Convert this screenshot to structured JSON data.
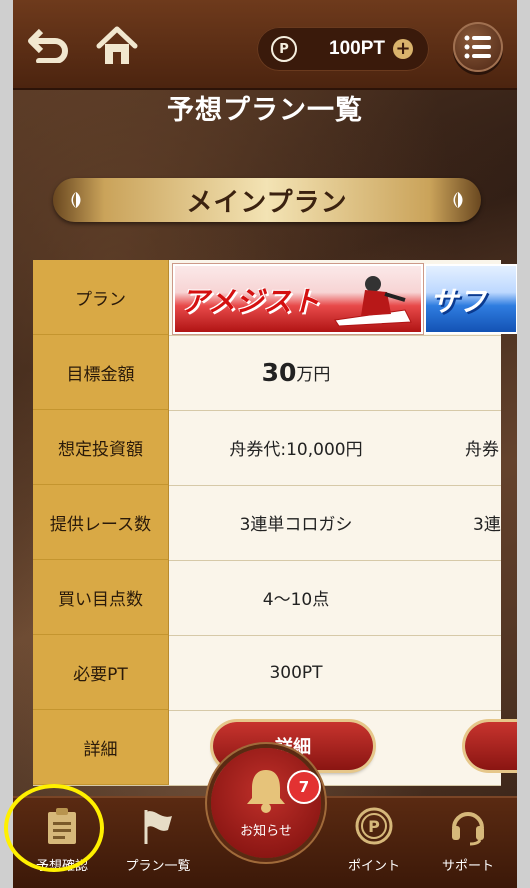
{
  "header": {
    "points": "100PT"
  },
  "page_title": "予想プラン一覧",
  "section_title": "メインプラン",
  "table": {
    "labels": [
      "プラン",
      "目標金額",
      "想定投資額",
      "提供レース数",
      "買い目点数",
      "必要PT",
      "詳細"
    ],
    "plans": [
      {
        "name_banner": "アメジスト",
        "target_num": "30",
        "target_unit": "万円",
        "investment": "舟券代:10,000円",
        "races": "3連単コロガシ",
        "picks": "4〜10点",
        "required_pt": "300PT",
        "detail_label": "詳細"
      },
      {
        "name_banner": "サフ",
        "investment": "舟券",
        "races": "3連"
      }
    ]
  },
  "footer": {
    "items": [
      "予想確認",
      "プラン一覧",
      "お知らせ",
      "ポイント",
      "サポート"
    ],
    "badge": "7"
  },
  "colors": {
    "header": "#5c2d14",
    "label_gold": "#d9a945",
    "accent_red": "#b01e1a",
    "highlight": "#fff000"
  }
}
